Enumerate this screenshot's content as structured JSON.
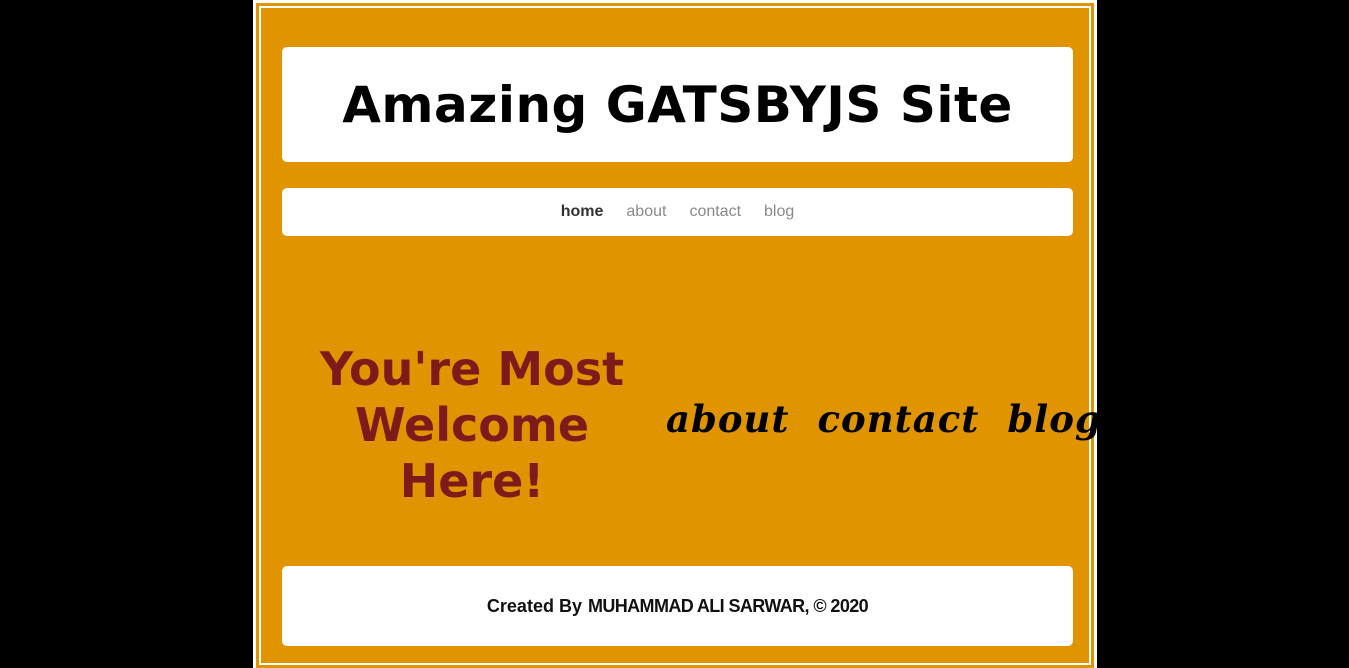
{
  "header": {
    "title": "Amazing GATSBYJS Site"
  },
  "nav": {
    "items": [
      {
        "label": "home",
        "active": true
      },
      {
        "label": "about",
        "active": false
      },
      {
        "label": "contact",
        "active": false
      },
      {
        "label": "blog",
        "active": false
      }
    ]
  },
  "main": {
    "welcome": "You're Most Welcome Here!",
    "links": [
      {
        "label": "about"
      },
      {
        "label": "contact"
      },
      {
        "label": "blog"
      }
    ]
  },
  "footer": {
    "created_by": "Created By",
    "author": "MUHAMMAD ALI SARWAR, © 2020"
  },
  "colors": {
    "background": "#000000",
    "gold": "#e09400",
    "card": "#ffffff",
    "welcome_text": "#7d1a1a",
    "nav_active": "#333333",
    "nav_inactive": "#8a8a8a"
  }
}
